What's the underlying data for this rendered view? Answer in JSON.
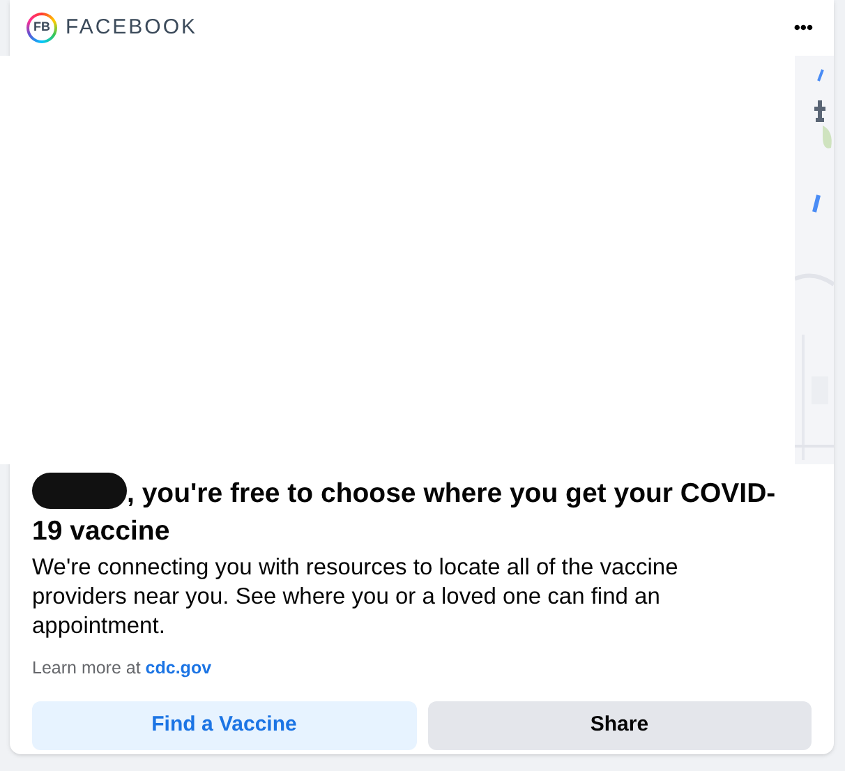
{
  "header": {
    "logo_text": "FB",
    "brand": "FACEBOOK",
    "menu": "•••"
  },
  "headline": {
    "redacted": true,
    "text": ", you're free to choose where you get your COVID-19 vaccine"
  },
  "body": "We're connecting you with resources to locate all of the vaccine providers near you. See where you or a loved one can find an appointment.",
  "learn_more": {
    "text": "Learn more at",
    "link": "cdc.gov"
  },
  "buttons": [
    {
      "label": "Find a Vaccine",
      "kind": "primary"
    },
    {
      "label": "Share",
      "kind": "secondary"
    }
  ]
}
